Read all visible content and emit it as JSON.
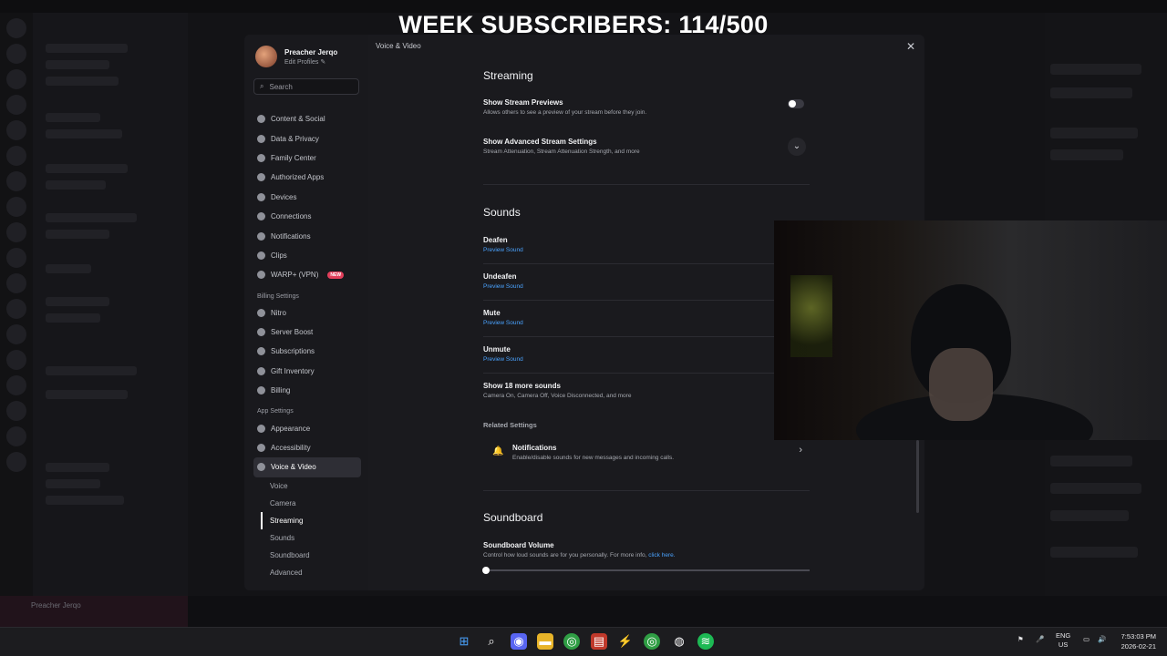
{
  "overlay": {
    "title": "WEEK SUBSCRIBERS: 114/500"
  },
  "background": {
    "self_name": "Preacher Jerqo"
  },
  "profile": {
    "name": "Preacher Jerqo",
    "edit": "Edit Profiles"
  },
  "search": {
    "placeholder": "Search"
  },
  "nav": {
    "user_items": [
      "Content & Social",
      "Data & Privacy",
      "Family Center",
      "Authorized Apps",
      "Devices",
      "Connections",
      "Notifications",
      "Clips",
      "WARP+ (VPN)"
    ],
    "new_badge": "NEW",
    "billing_header": "Billing Settings",
    "billing_items": [
      "Nitro",
      "Server Boost",
      "Subscriptions",
      "Gift Inventory",
      "Billing"
    ],
    "app_header": "App Settings",
    "app_items": [
      "Appearance",
      "Accessibility",
      "Voice & Video"
    ],
    "sub_items": [
      "Voice",
      "Camera",
      "Streaming",
      "Sounds",
      "Soundboard",
      "Advanced"
    ]
  },
  "breadcrumb": "Voice & Video",
  "streaming": {
    "title": "Streaming",
    "preview_label": "Show Stream Previews",
    "preview_desc": "Allows others to see a preview of your stream before they join.",
    "advanced_label": "Show Advanced Stream Settings",
    "advanced_desc": "Stream Attenuation, Stream Attenuation Strength, and more"
  },
  "sounds": {
    "title": "Sounds",
    "items": [
      "Deafen",
      "Undeafen",
      "Mute",
      "Unmute"
    ],
    "preview": "Preview Sound",
    "more_label": "Show 18 more sounds",
    "more_desc": "Camera On, Camera Off, Voice Disconnected, and more",
    "related": "Related Settings",
    "notif_label": "Notifications",
    "notif_desc": "Enable/disable sounds for new messages and incoming calls."
  },
  "soundboard": {
    "title": "Soundboard",
    "volume_label": "Soundboard Volume",
    "volume_desc": "Control how loud sounds are for you personally. For more info,",
    "volume_link": "click here.",
    "volume_value": 0
  },
  "taskbar": {
    "lang": "ENG",
    "region": "US",
    "time": "7:53:03 PM",
    "date": "2026-02-21"
  }
}
